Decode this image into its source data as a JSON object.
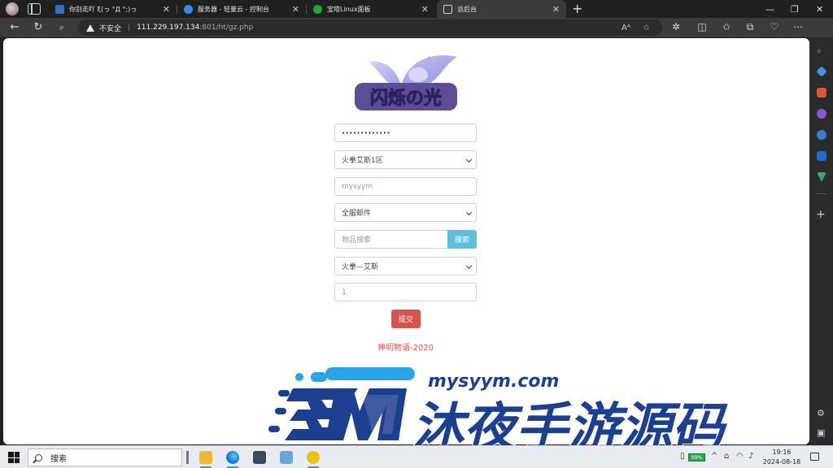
{
  "tabs": [
    {
      "label": "你别走吖 ξ(っ °Д °;)っ",
      "close": "✕",
      "color": "#3a6fb5"
    },
    {
      "label": "服务器 - 轻量云 - 控制台",
      "close": "✕",
      "color": "#2f8de4"
    },
    {
      "label": "宝塔Linux面板",
      "close": "✕",
      "color": "#20a53a"
    },
    {
      "label": "总后台",
      "close": "✕",
      "color": "#cccccc"
    }
  ],
  "address": {
    "security_label": "不安全",
    "host": "111.229.197.134",
    "path": ":801/ht/gz.php"
  },
  "form": {
    "password_mask": "•••••••••••••",
    "server_select": "火拳艾斯1区",
    "username_value": "mysyym",
    "mail_type_select": "全服邮件",
    "item_search_placeholder": "物品搜索",
    "search_button": "搜索",
    "item_select": "火拳—艾斯",
    "quantity_value": "1",
    "submit_button": "提交",
    "footer_text": "神明物语-2020"
  },
  "logo_text": "闪烁の光",
  "watermark": {
    "domain": "mysyym.com",
    "title": "沐夜手游源码"
  },
  "taskbar": {
    "search_label": "搜索",
    "battery": "99%",
    "time": "19:16",
    "date": "2024-08-18"
  }
}
